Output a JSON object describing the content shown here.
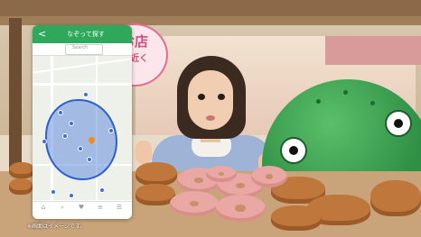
{
  "app": {
    "header_title": "なぞって探す",
    "back_symbol": "<",
    "tabs": [
      "",
      "Search",
      ""
    ],
    "locate_symbol": "✋",
    "nav": [
      {
        "icon": "home-icon",
        "glyph": "⌂"
      },
      {
        "icon": "search-icon",
        "glyph": "⌕"
      },
      {
        "icon": "heart-icon",
        "glyph": "♥"
      },
      {
        "icon": "list-icon",
        "glyph": "≡"
      },
      {
        "icon": "menu-icon",
        "glyph": "☰"
      }
    ]
  },
  "bubble": {
    "line1": "お店",
    "line2": "の近く"
  },
  "caption": "※画面はイメージです。",
  "colors": {
    "accent": "#2fa85c",
    "area": "#2c5fd0",
    "bubble": "#e26c93"
  }
}
